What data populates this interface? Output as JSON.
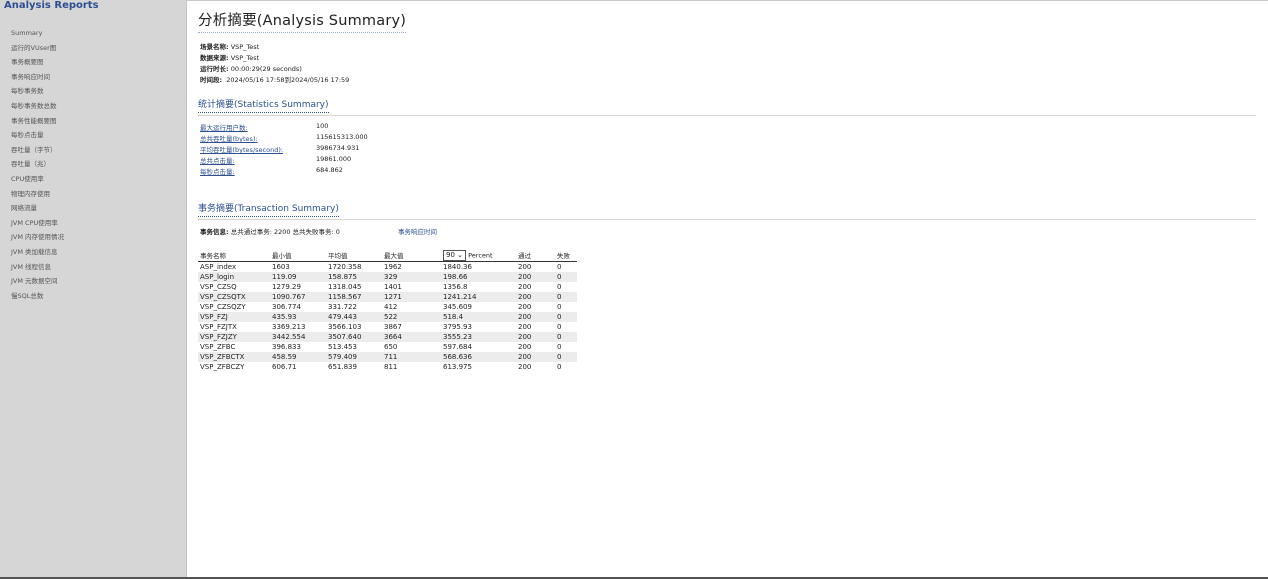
{
  "sidebar": {
    "app_title": "Analysis Reports",
    "items": [
      "Summary",
      "运行的VUser图",
      "事务概要图",
      "事务响应时间",
      "每秒事务数",
      "每秒事务数总数",
      "事务性能概要图",
      "每秒点击量",
      "吞吐量（字节）",
      "吞吐量（兆）",
      "CPU使用率",
      "物理内存使用",
      "网络流量",
      "JVM CPU使用率",
      "JVM 内存使用情况",
      "JVM 类加载信息",
      "JVM 线程信息",
      "JVM 元数据空间",
      "慢SQL总数"
    ]
  },
  "main": {
    "title": "分析摘要(Analysis Summary)",
    "info": [
      {
        "label": "场景名称:",
        "value": "VSP_Test"
      },
      {
        "label": "数据来源:",
        "value": "VSP_Test"
      },
      {
        "label": "运行时长:",
        "value": "00:00:29(29 seconds)"
      },
      {
        "label": "时间段:",
        "value": "2024/05/16 17:58到2024/05/16 17:59"
      }
    ],
    "stats_title": "统计摘要(Statistics Summary)",
    "stats": [
      {
        "label": "最大运行用户数:",
        "value": "100"
      },
      {
        "label": "总共吞吐量(bytes):",
        "value": "115615313.000"
      },
      {
        "label": "平均吞吐量(bytes/second):",
        "value": "3986734.931"
      },
      {
        "label": "总共点击量:",
        "value": "19861.000"
      },
      {
        "label": "每秒点击量:",
        "value": "684.862"
      }
    ],
    "tx_title": "事务摘要(Transaction Summary)",
    "tx_info_label": "事务信息:",
    "tx_info_text": "总共通过事务: 2200 总共失败事务: 0",
    "tx_link": "事务响应时间",
    "table": {
      "headers": {
        "name": "事务名称",
        "min": "最小值",
        "avg": "平均值",
        "max": "最大值",
        "percentile_value": "90",
        "percentile_label": "Percent",
        "pass": "通过",
        "fail": "失败"
      },
      "rows": [
        [
          "ASP_index",
          "1603",
          "1720.358",
          "1962",
          "1840.36",
          "200",
          "0"
        ],
        [
          "ASP_login",
          "119.09",
          "158.875",
          "329",
          "198.66",
          "200",
          "0"
        ],
        [
          "VSP_CZSQ",
          "1279.29",
          "1318.045",
          "1401",
          "1356.8",
          "200",
          "0"
        ],
        [
          "VSP_CZSQTX",
          "1090.767",
          "1158.567",
          "1271",
          "1241.214",
          "200",
          "0"
        ],
        [
          "VSP_CZSQZY",
          "306.774",
          "331.722",
          "412",
          "345.609",
          "200",
          "0"
        ],
        [
          "VSP_FZJ",
          "435.93",
          "479.443",
          "522",
          "518.4",
          "200",
          "0"
        ],
        [
          "VSP_FZJTX",
          "3369.213",
          "3566.103",
          "3867",
          "3795.93",
          "200",
          "0"
        ],
        [
          "VSP_FZJZY",
          "3442.554",
          "3507.640",
          "3664",
          "3555.23",
          "200",
          "0"
        ],
        [
          "VSP_ZFBC",
          "396.833",
          "513.453",
          "650",
          "597.684",
          "200",
          "0"
        ],
        [
          "VSP_ZFBCTX",
          "458.59",
          "579.409",
          "711",
          "568.636",
          "200",
          "0"
        ],
        [
          "VSP_ZFBCZY",
          "606.71",
          "651.839",
          "811",
          "613.975",
          "200",
          "0"
        ]
      ]
    }
  }
}
